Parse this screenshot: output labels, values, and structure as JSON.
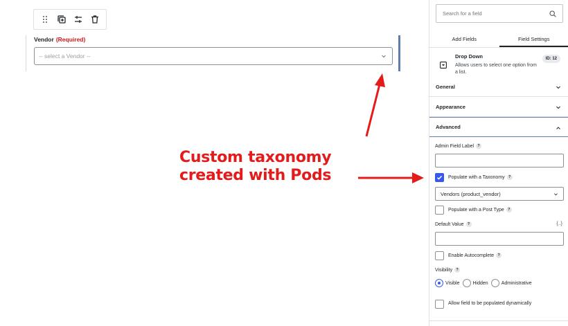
{
  "editor": {
    "toolbar": {
      "icons": [
        "drag-handle-icon",
        "duplicate-icon",
        "settings-sliders-icon",
        "trash-icon"
      ]
    },
    "field": {
      "label": "Vendor",
      "required_text": "(Required)",
      "placeholder": "-- select a Vendor --"
    }
  },
  "annotation": {
    "line1": "Custom taxonomy",
    "line2": "created with Pods",
    "color": "#e31b1b"
  },
  "sidebar": {
    "search_placeholder": "Search for a field",
    "tabs": [
      {
        "label": "Add Fields",
        "active": false
      },
      {
        "label": "Field Settings",
        "active": true
      }
    ],
    "field_info": {
      "title": "Drop Down",
      "description": "Allows users to select one option from a list.",
      "id_badge": "ID: 12"
    },
    "sections": {
      "general": "General",
      "appearance": "Appearance",
      "advanced": "Advanced"
    },
    "advanced": {
      "admin_label": "Admin Field Label",
      "populate_taxonomy": "Populate with a Taxonomy",
      "taxonomy_value": "Vendors (product_vendor)",
      "populate_post_type": "Populate with a Post Type",
      "default_value": "Default Value",
      "merge_tag": "{..}",
      "enable_autocomplete": "Enable Autocomplete",
      "visibility": "Visibility",
      "visibility_options": [
        "Visible",
        "Hidden",
        "Administrative"
      ],
      "allow_dynamic": "Allow field to be populated dynamically"
    },
    "accent_color": "#3858e9"
  }
}
